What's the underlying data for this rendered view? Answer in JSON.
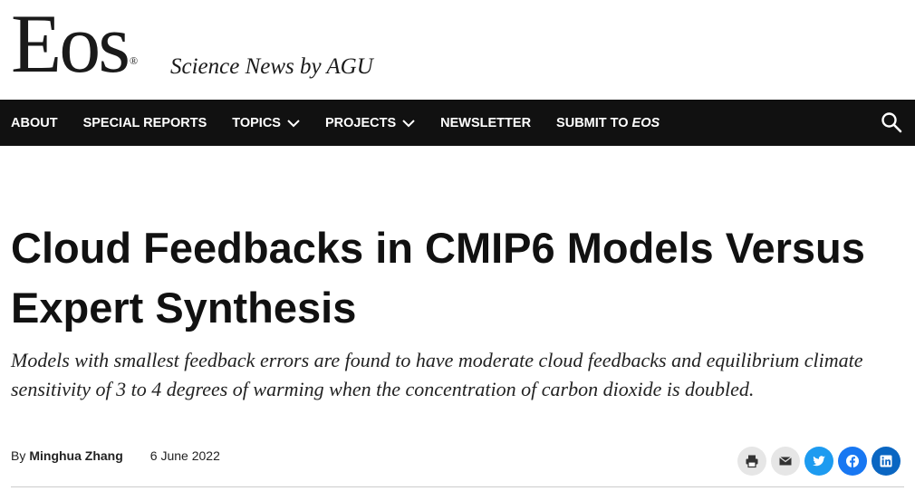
{
  "masthead": {
    "logo_text": "Eos",
    "logo_mark": "®",
    "tagline": "Science News by AGU"
  },
  "nav": {
    "items": [
      {
        "label": "ABOUT"
      },
      {
        "label": "SPECIAL REPORTS"
      },
      {
        "label": "TOPICS",
        "has_dropdown": true
      },
      {
        "label": "PROJECTS",
        "has_dropdown": true
      },
      {
        "label": "NEWSLETTER"
      },
      {
        "label": "SUBMIT TO",
        "emphasis": "EOS"
      }
    ],
    "search_icon": "search-icon",
    "background": "#111111"
  },
  "article": {
    "title": "Cloud Feedbacks in CMIP6 Models Versus Expert Synthesis",
    "dek": "Models with smallest feedback errors are found to have moderate cloud feedbacks and equilibrium climate sensitivity of 3 to 4 degrees of warming when the concentration of carbon dioxide is doubled.",
    "byline_prefix": "By",
    "author": "Minghua Zhang",
    "date": "6 June 2022"
  },
  "share": {
    "buttons": [
      {
        "icon": "print-icon",
        "color": "#e6e6e6"
      },
      {
        "icon": "email-icon",
        "color": "#e6e6e6"
      },
      {
        "icon": "twitter-icon",
        "color": "#1d9bf0"
      },
      {
        "icon": "facebook-icon",
        "color": "#1877f2"
      },
      {
        "icon": "linkedin-icon",
        "color": "#0a66c2"
      }
    ]
  }
}
